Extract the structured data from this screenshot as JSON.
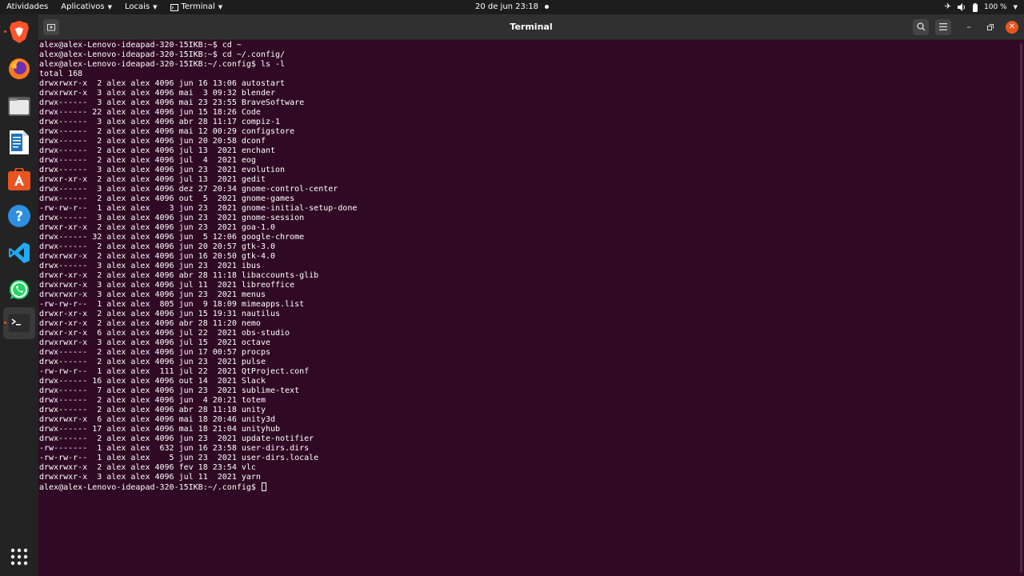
{
  "topbar": {
    "activities": "Atividades",
    "applications": "Aplicativos",
    "places": "Locais",
    "app_menu": "Terminal",
    "clock": "20 de jun  23:18",
    "battery": "100 %",
    "icons": [
      "airplane-icon",
      "volume-icon",
      "battery-icon"
    ]
  },
  "dock": {
    "items": [
      "brave-browser-icon",
      "firefox-icon",
      "files-icon",
      "libreoffice-writer-icon",
      "software-center-icon",
      "help-icon",
      "vscode-icon",
      "whatsapp-icon",
      "terminal-icon"
    ],
    "show_apps": "app-grid-icon"
  },
  "window": {
    "title": "Terminal",
    "colors": {
      "background": "#300a24",
      "text": "#ffffff",
      "accent": "#e95420"
    }
  },
  "terminal": {
    "lines": [
      "alex@alex-Lenovo-ideapad-320-15IKB:~$ cd ~",
      "alex@alex-Lenovo-ideapad-320-15IKB:~$ cd ~/.config/",
      "alex@alex-Lenovo-ideapad-320-15IKB:~/.config$ ls -l",
      "total 168",
      "drwxrwxr-x  2 alex alex 4096 jun 16 13:06 autostart",
      "drwxrwxr-x  3 alex alex 4096 mai  3 09:32 blender",
      "drwx------  3 alex alex 4096 mai 23 23:55 BraveSoftware",
      "drwx------ 22 alex alex 4096 jun 15 18:26 Code",
      "drwx------  3 alex alex 4096 abr 28 11:17 compiz-1",
      "drwx------  2 alex alex 4096 mai 12 00:29 configstore",
      "drwx------  2 alex alex 4096 jun 20 20:58 dconf",
      "drwx------  2 alex alex 4096 jul 13  2021 enchant",
      "drwx------  2 alex alex 4096 jul  4  2021 eog",
      "drwx------  3 alex alex 4096 jun 23  2021 evolution",
      "drwxr-xr-x  2 alex alex 4096 jul 13  2021 gedit",
      "drwx------  3 alex alex 4096 dez 27 20:34 gnome-control-center",
      "drwx------  2 alex alex 4096 out  5  2021 gnome-games",
      "-rw-rw-r--  1 alex alex    3 jun 23  2021 gnome-initial-setup-done",
      "drwx------  3 alex alex 4096 jun 23  2021 gnome-session",
      "drwxr-xr-x  2 alex alex 4096 jun 23  2021 goa-1.0",
      "drwx------ 32 alex alex 4096 jun  5 12:06 google-chrome",
      "drwx------  2 alex alex 4096 jun 20 20:57 gtk-3.0",
      "drwxrwxr-x  2 alex alex 4096 jun 16 20:50 gtk-4.0",
      "drwx------  3 alex alex 4096 jun 23  2021 ibus",
      "drwxr-xr-x  2 alex alex 4096 abr 28 11:18 libaccounts-glib",
      "drwxrwxr-x  3 alex alex 4096 jul 11  2021 libreoffice",
      "drwxrwxr-x  3 alex alex 4096 jun 23  2021 menus",
      "-rw-rw-r--  1 alex alex  805 jun  9 18:09 mimeapps.list",
      "drwxr-xr-x  2 alex alex 4096 jun 15 19:31 nautilus",
      "drwxr-xr-x  2 alex alex 4096 abr 28 11:20 nemo",
      "drwxr-xr-x  6 alex alex 4096 jul 22  2021 obs-studio",
      "drwxrwxr-x  3 alex alex 4096 jul 15  2021 octave",
      "drwx------  2 alex alex 4096 jun 17 00:57 procps",
      "drwx------  2 alex alex 4096 jun 23  2021 pulse",
      "-rw-rw-r--  1 alex alex  111 jul 22  2021 QtProject.conf",
      "drwx------ 16 alex alex 4096 out 14  2021 Slack",
      "drwx------  7 alex alex 4096 jun 23  2021 sublime-text",
      "drwx------  2 alex alex 4096 jun  4 20:21 totem",
      "drwx------  2 alex alex 4096 abr 28 11:18 unity",
      "drwxrwxr-x  6 alex alex 4096 mai 18 20:46 unity3d",
      "drwx------ 17 alex alex 4096 mai 18 21:04 unityhub",
      "drwx------  2 alex alex 4096 jun 23  2021 update-notifier",
      "-rw-------  1 alex alex  632 jun 16 23:58 user-dirs.dirs",
      "-rw-rw-r--  1 alex alex    5 jun 23  2021 user-dirs.locale",
      "drwxrwxr-x  2 alex alex 4096 fev 18 23:54 vlc",
      "drwxrwxr-x  3 alex alex 4096 jul 11  2021 yarn"
    ],
    "prompt": "alex@alex-Lenovo-ideapad-320-15IKB:~/.config$ "
  }
}
